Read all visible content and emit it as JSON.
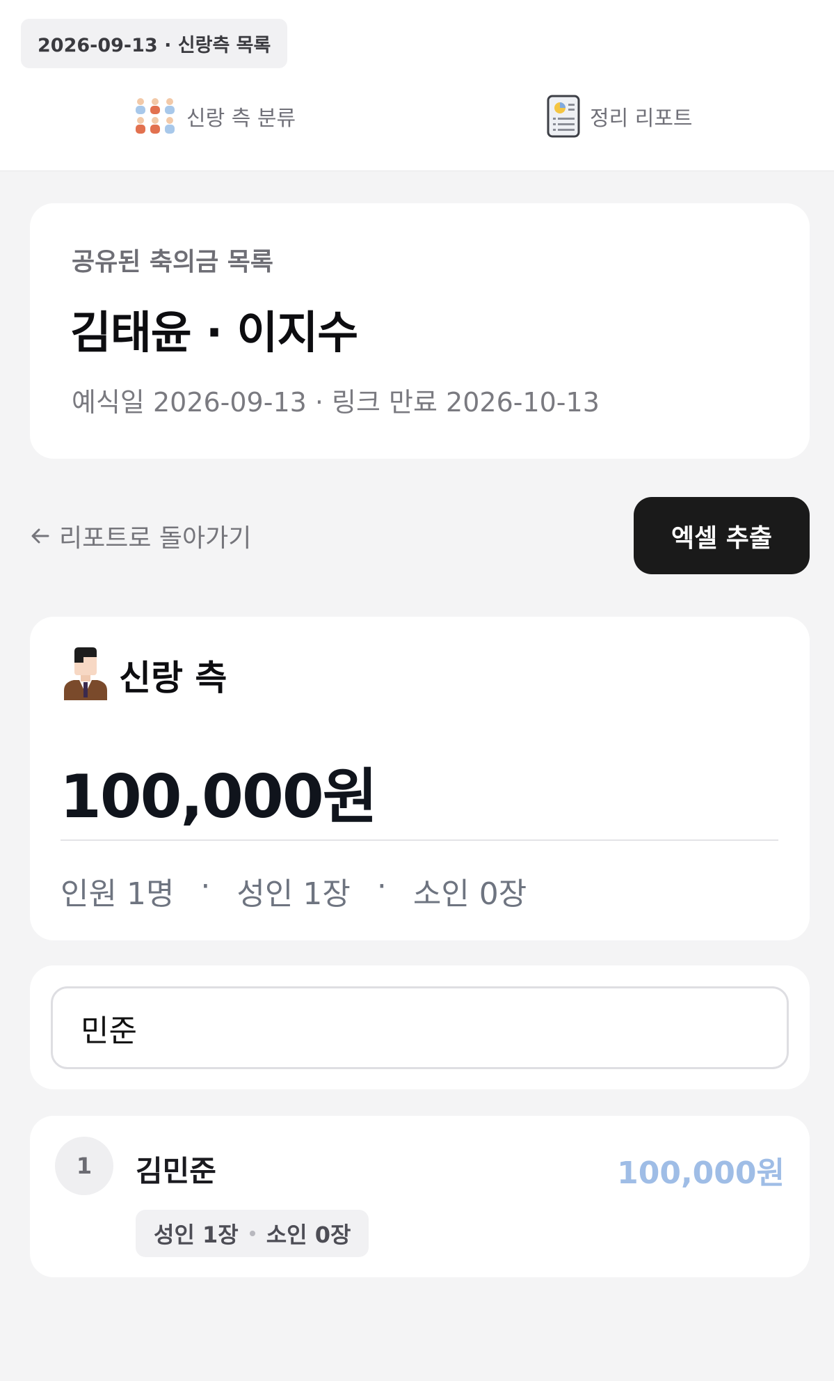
{
  "top_bar": {
    "date_chip": "2026-09-13 · 신랑측 목록",
    "tabs": [
      {
        "label": "신랑 측 분류",
        "icon": "people-group-icon"
      },
      {
        "label": "정리 리포트",
        "icon": "report-document-icon"
      }
    ]
  },
  "header_card": {
    "subtitle": "공유된 축의금 목록",
    "title": "김태윤 · 이지수",
    "meta": "예식일 2026-09-13 · 링크 만료 2026-10-13"
  },
  "actions": {
    "back_label": "리포트로 돌아가기",
    "export_label": "엑셀 추출"
  },
  "summary": {
    "side_title": "신랑 측",
    "total": "100,000원",
    "stats": [
      "인원 1명",
      "성인 1장",
      "소인 0장"
    ],
    "stat_separator": "·"
  },
  "search": {
    "value": "민준"
  },
  "results": [
    {
      "index": "1",
      "name": "김민준",
      "amount": "100,000원",
      "adult": "성인 1장",
      "child": "소인 0장"
    }
  ],
  "colors": {
    "background": "#f4f4f5",
    "card": "#ffffff",
    "primary_button": "#1a1a1a",
    "amount_accent": "#9fbde6"
  }
}
